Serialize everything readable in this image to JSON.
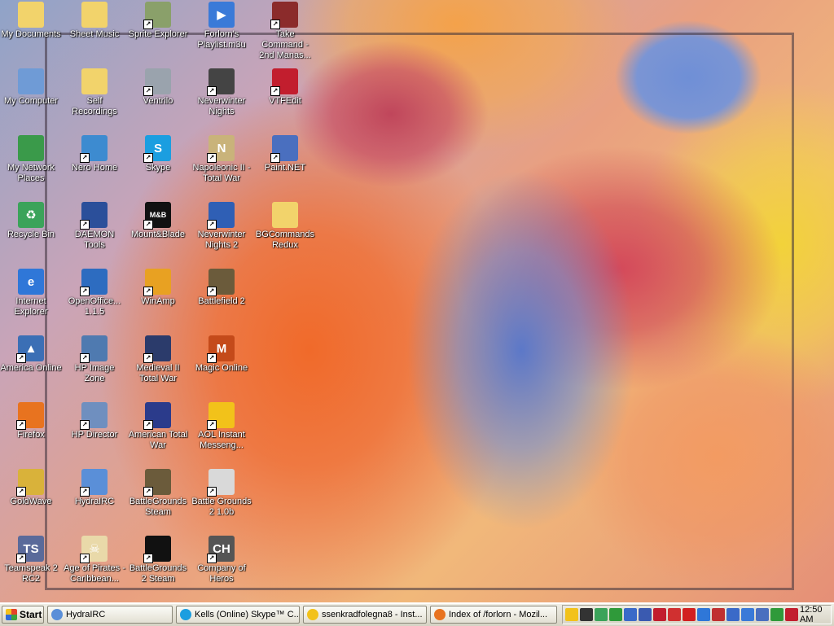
{
  "desktop": {
    "icons": [
      {
        "label": "My Documents",
        "icon": "my-documents-icon",
        "color": "#f2d36b",
        "glyph": "",
        "shortcut": false
      },
      {
        "label": "My Computer",
        "icon": "my-computer-icon",
        "color": "#6f9bd6",
        "glyph": "",
        "shortcut": false
      },
      {
        "label": "My Network Places",
        "icon": "network-places-icon",
        "color": "#3a9a4a",
        "glyph": "",
        "shortcut": false
      },
      {
        "label": "Recycle Bin",
        "icon": "recycle-bin-icon",
        "color": "#3ba35a",
        "glyph": "♻",
        "shortcut": false
      },
      {
        "label": "Internet Explorer",
        "icon": "internet-explorer-icon",
        "color": "#2f77d8",
        "glyph": "e",
        "shortcut": false
      },
      {
        "label": "America Online",
        "icon": "aol-icon",
        "color": "#3b6fb5",
        "glyph": "▲",
        "shortcut": true
      },
      {
        "label": "Firefox",
        "icon": "firefox-icon",
        "color": "#e8731f",
        "glyph": "",
        "shortcut": true
      },
      {
        "label": "GoldWave",
        "icon": "goldwave-icon",
        "color": "#d9b23a",
        "glyph": "",
        "shortcut": true
      },
      {
        "label": "Teamspeak 2 RC2",
        "icon": "teamspeak-icon",
        "color": "#5a6a9a",
        "glyph": "TS",
        "shortcut": true
      },
      {
        "label": "Sheet Music",
        "icon": "folder-icon",
        "color": "#f2d36b",
        "glyph": "",
        "shortcut": false
      },
      {
        "label": "Self Recordings",
        "icon": "folder-icon",
        "color": "#f2d36b",
        "glyph": "",
        "shortcut": false
      },
      {
        "label": "Nero Home",
        "icon": "nero-home-icon",
        "color": "#3d8bd0",
        "glyph": "",
        "shortcut": true
      },
      {
        "label": "DAEMON Tools",
        "icon": "daemon-tools-icon",
        "color": "#2b4f9a",
        "glyph": "",
        "shortcut": true
      },
      {
        "label": "OpenOffice... 1.1.5",
        "icon": "openoffice-icon",
        "color": "#2d6cc0",
        "glyph": "",
        "shortcut": true
      },
      {
        "label": "HP Image Zone",
        "icon": "hp-image-zone-icon",
        "color": "#4f7ab0",
        "glyph": "",
        "shortcut": true
      },
      {
        "label": "HP Director",
        "icon": "hp-director-icon",
        "color": "#6f8fbf",
        "glyph": "",
        "shortcut": true
      },
      {
        "label": "HydraIRC",
        "icon": "hydrairc-icon",
        "color": "#5a8fd8",
        "glyph": "",
        "shortcut": true
      },
      {
        "label": "Age of Pirates - Caribbean...",
        "icon": "age-of-pirates-icon",
        "color": "#e9d9a9",
        "glyph": "☠",
        "shortcut": true
      },
      {
        "label": "Sprite Explorer",
        "icon": "sprite-explorer-icon",
        "color": "#8aa06a",
        "glyph": "",
        "shortcut": true
      },
      {
        "label": "Ventrilo",
        "icon": "ventrilo-icon",
        "color": "#9aa3ad",
        "glyph": "",
        "shortcut": true
      },
      {
        "label": "Skype",
        "icon": "skype-icon",
        "color": "#1b9ee0",
        "glyph": "S",
        "shortcut": true
      },
      {
        "label": "Mount&Blade",
        "icon": "mount-blade-icon",
        "color": "#111111",
        "glyph": "M&B",
        "shortcut": true
      },
      {
        "label": "WinAmp",
        "icon": "winamp-icon",
        "color": "#e8a122",
        "glyph": "",
        "shortcut": true
      },
      {
        "label": "Medieval II Total War",
        "icon": "medieval-total-war-icon",
        "color": "#2b3b6b",
        "glyph": "",
        "shortcut": true
      },
      {
        "label": "American Total War",
        "icon": "american-total-war-icon",
        "color": "#2b3b8b",
        "glyph": "",
        "shortcut": true
      },
      {
        "label": "BattleGrounds Steam",
        "icon": "battlegrounds-icon",
        "color": "#6b5b3b",
        "glyph": "",
        "shortcut": true
      },
      {
        "label": "BattleGrounds 2 Steam",
        "icon": "steam-icon",
        "color": "#111111",
        "glyph": "",
        "shortcut": true
      },
      {
        "label": "Forlorn's Playlist.m3u",
        "icon": "media-player-icon",
        "color": "#3a7ad8",
        "glyph": "▶",
        "shortcut": false
      },
      {
        "label": "Neverwinter Nights",
        "icon": "neverwinter-nights-icon",
        "color": "#444444",
        "glyph": "",
        "shortcut": true
      },
      {
        "label": "Napoleonic II - Total War",
        "icon": "napoleonic-icon",
        "color": "#c9b37a",
        "glyph": "N",
        "shortcut": true
      },
      {
        "label": "Neverwinter Nights 2",
        "icon": "window-icon",
        "color": "#2f5fb5",
        "glyph": "",
        "shortcut": true
      },
      {
        "label": "Battlefield 2",
        "icon": "battlefield-icon",
        "color": "#6b5b3b",
        "glyph": "",
        "shortcut": true
      },
      {
        "label": "Magic Online",
        "icon": "magic-online-icon",
        "color": "#c44a1a",
        "glyph": "M",
        "shortcut": true
      },
      {
        "label": "AOL Instant Messeng...",
        "icon": "aim-icon",
        "color": "#f2c21a",
        "glyph": "",
        "shortcut": true
      },
      {
        "label": "Battle Grounds 2 1.0b",
        "icon": "battle-grounds-icon",
        "color": "#d9d9d9",
        "glyph": "",
        "shortcut": true
      },
      {
        "label": "Company of Heros",
        "icon": "company-of-heroes-icon",
        "color": "#555555",
        "glyph": "CH",
        "shortcut": true
      },
      {
        "label": "Take Command - 2nd Manas...",
        "icon": "take-command-icon",
        "color": "#8b2b2b",
        "glyph": "",
        "shortcut": true
      },
      {
        "label": "VTFEdit",
        "icon": "vtfedit-icon",
        "color": "#c21e2e",
        "glyph": "",
        "shortcut": true
      },
      {
        "label": "Paint.NET",
        "icon": "paint-net-icon",
        "color": "#4a6fbf",
        "glyph": "",
        "shortcut": true
      },
      {
        "label": "BGCommands Redux",
        "icon": "folder-icon",
        "color": "#f2d36b",
        "glyph": "",
        "shortcut": false
      }
    ]
  },
  "taskbar": {
    "start_label": "Start",
    "tasks": [
      {
        "label": "HydraIRC",
        "icon": "hydrairc-icon",
        "color": "#5a8fd8"
      },
      {
        "label": "Kells (Online) Skype™ C...",
        "icon": "skype-icon",
        "color": "#1b9ee0"
      },
      {
        "label": "ssenkradfolegna8 - Inst...",
        "icon": "aim-icon",
        "color": "#f2c21a"
      },
      {
        "label": "Index of /forlorn - Mozil...",
        "icon": "firefox-icon",
        "color": "#e8731f"
      }
    ],
    "tray_icons": [
      {
        "icon": "aim-tray-icon",
        "color": "#f2c21a"
      },
      {
        "icon": "steam-tray-icon",
        "color": "#333333"
      },
      {
        "icon": "shield-tray-icon",
        "color": "#3ba35a"
      },
      {
        "icon": "check-tray-icon",
        "color": "#2f9a3a"
      },
      {
        "icon": "network-tray-icon",
        "color": "#3a6ac8"
      },
      {
        "icon": "sync-tray-icon",
        "color": "#3a5ab0"
      },
      {
        "icon": "network-x-tray-icon",
        "color": "#c21e2e"
      },
      {
        "icon": "plugin-tray-icon",
        "color": "#d03030"
      },
      {
        "icon": "ati-tray-icon",
        "color": "#d22020"
      },
      {
        "icon": "hp-tray-icon",
        "color": "#2f77d8"
      },
      {
        "icon": "security-tray-icon",
        "color": "#c03030"
      },
      {
        "icon": "alert-tray-icon",
        "color": "#3a6ac8"
      },
      {
        "icon": "globe-tray-icon",
        "color": "#3a7ad8"
      },
      {
        "icon": "volume-tray-icon",
        "color": "#4a6fbf"
      },
      {
        "icon": "v-tray-icon",
        "color": "#2f9a3a"
      },
      {
        "icon": "antivirus-tray-icon",
        "color": "#c21e2e"
      }
    ],
    "clock": "12:50 AM"
  }
}
